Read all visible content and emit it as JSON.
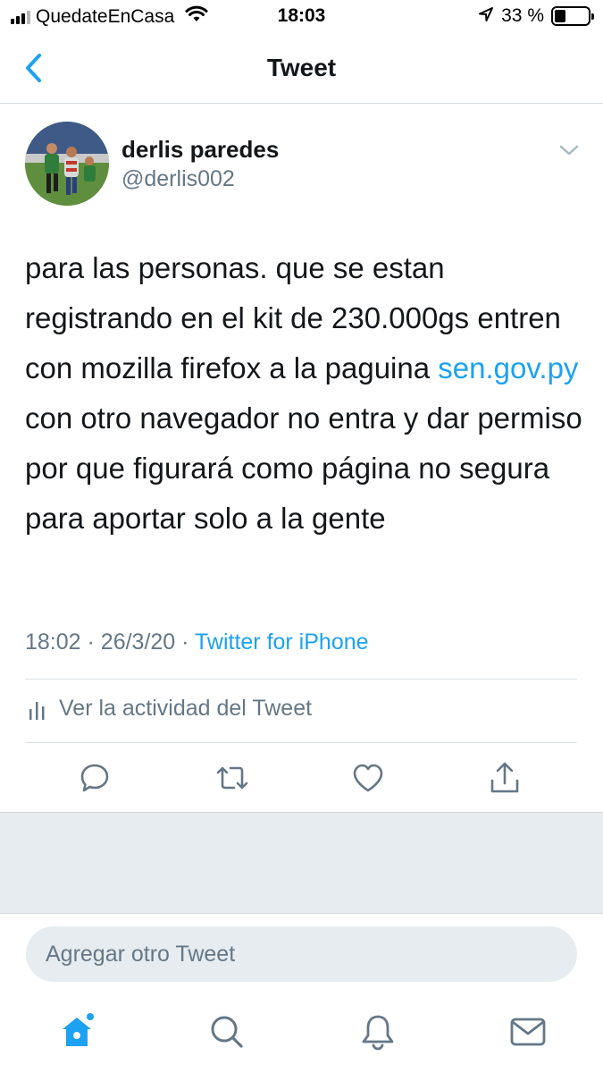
{
  "status_bar": {
    "carrier": "QuedateEnCasa",
    "time": "18:03",
    "battery_percent": "33 %",
    "battery_level": 0.33,
    "icons": [
      "signal-icon",
      "wifi-icon",
      "location-arrow-icon",
      "battery-icon"
    ]
  },
  "nav": {
    "title": "Tweet",
    "back_icon": "chevron-left-icon"
  },
  "tweet": {
    "author_name": "derlis paredes",
    "author_handle": "@derlis002",
    "text_before_link": "para las personas. que se estan registrando en el kit de 230.000gs entren con mozilla firefox a la paguina ",
    "link": "sen.gov.py",
    "text_after_link": " con otro navegador no entra y dar permiso por que figurará como página no segura para aportar solo a la gente",
    "time": "18:02",
    "date": "26/3/20",
    "separator": "·",
    "source": "Twitter for iPhone",
    "activity_label": "Ver la actividad del Tweet"
  },
  "actions": [
    "reply-icon",
    "retweet-icon",
    "like-icon",
    "share-icon"
  ],
  "reply": {
    "placeholder": "Agregar otro Tweet"
  },
  "tabbar": [
    "home-icon",
    "search-icon",
    "notifications-icon",
    "messages-icon"
  ],
  "colors": {
    "accent": "#1da1f2",
    "text": "#14171a",
    "secondary": "#657786",
    "background_gray": "#e6ecf0"
  }
}
